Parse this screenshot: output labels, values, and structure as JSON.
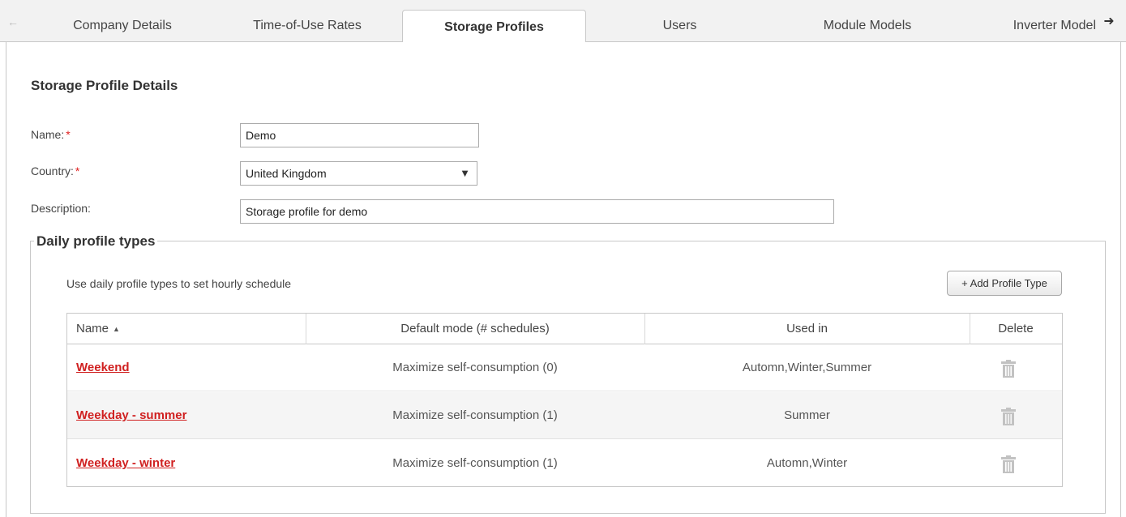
{
  "tabs": {
    "items": [
      {
        "label": "Company Details"
      },
      {
        "label": "Time-of-Use Rates"
      },
      {
        "label": "Storage Profiles"
      },
      {
        "label": "Users"
      },
      {
        "label": "Module Models"
      },
      {
        "label": "Inverter Model"
      }
    ],
    "active": "Storage Profiles",
    "scroll_left_icon": "arrow-left-icon",
    "scroll_right_icon": "arrow-right-icon"
  },
  "form": {
    "title": "Storage Profile Details",
    "name_label": "Name:",
    "name_value": "Demo",
    "country_label": "Country:",
    "country_value": "United Kingdom",
    "description_label": "Description:",
    "description_value": "Storage profile for demo",
    "required_mark": "*"
  },
  "daily_profiles": {
    "legend": "Daily profile types",
    "hint": "Use daily profile types to set hourly schedule",
    "add_button": "+ Add Profile Type",
    "columns": {
      "name": "Name",
      "default_mode": "Default mode (# schedules)",
      "used_in": "Used in",
      "delete": "Delete"
    },
    "sort_icon": "sort-ascending-icon",
    "rows": [
      {
        "name": "Weekend",
        "default_mode": "Maximize self-consumption (0)",
        "used_in": "Automn,Winter,Summer"
      },
      {
        "name": "Weekday - summer",
        "default_mode": "Maximize self-consumption (1)",
        "used_in": "Summer"
      },
      {
        "name": "Weekday - winter",
        "default_mode": "Maximize self-consumption (1)",
        "used_in": "Automn,Winter"
      }
    ],
    "delete_icon": "trash-icon"
  },
  "colors": {
    "link": "#d02020",
    "required": "#e02020",
    "border": "#c8c8c8",
    "tab_bar": "#f2f2f2"
  }
}
